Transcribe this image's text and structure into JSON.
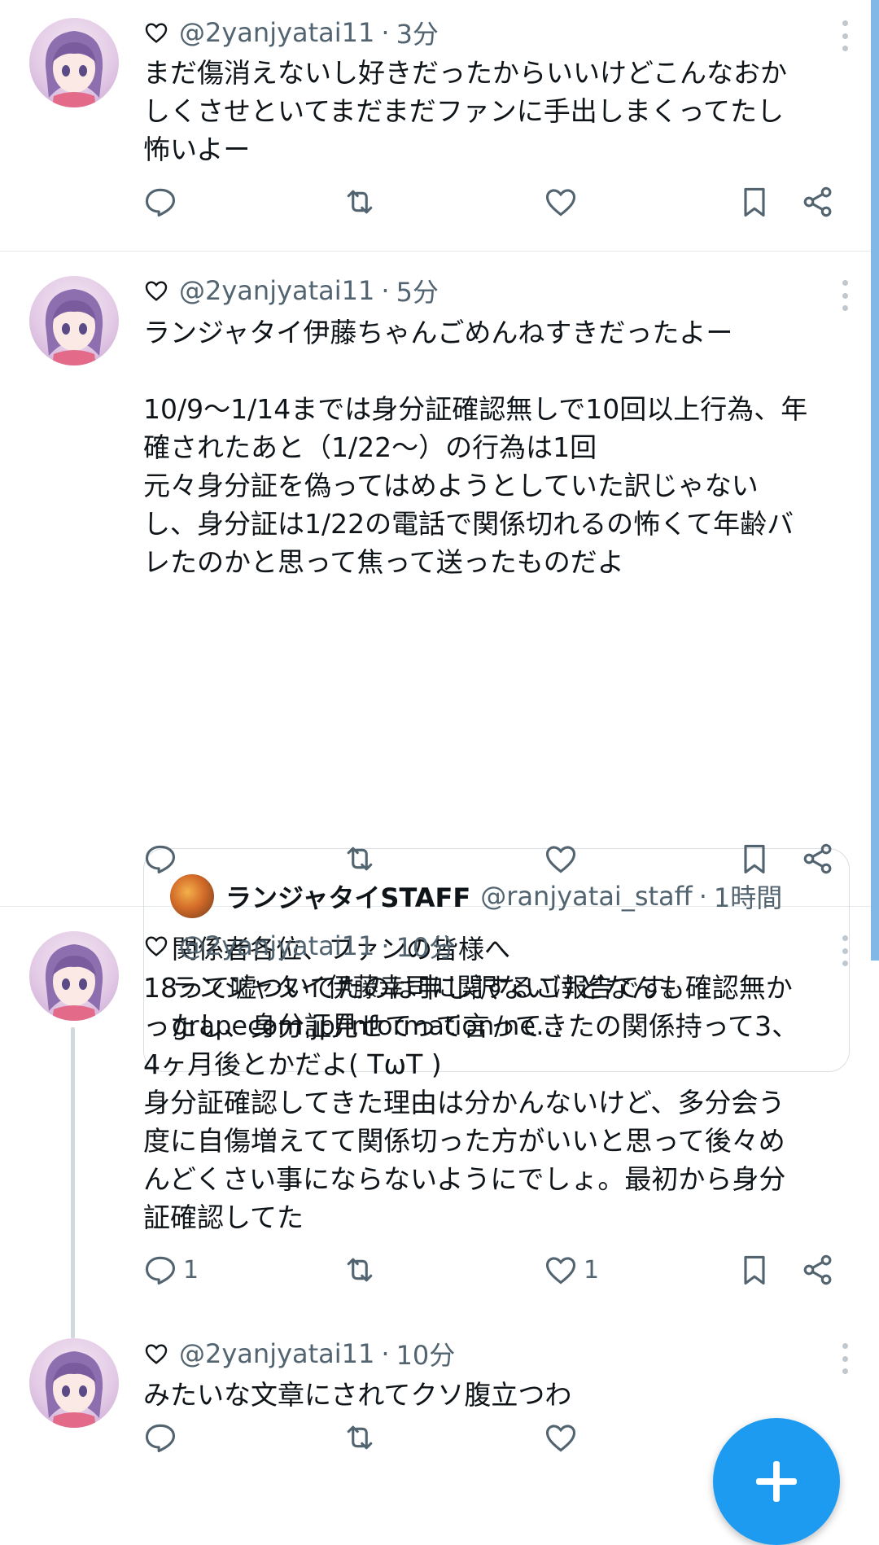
{
  "tweets": [
    {
      "handle": "@2yanjyatai11",
      "time": "3分",
      "text": "まだ傷消えないし好きだったからいいけどこんなおか\nしくさせといてまだまだファンに手出しまくってたし\n怖いよー",
      "reply_count": "",
      "like_count": ""
    },
    {
      "handle": "@2yanjyatai11",
      "time": "5分",
      "text": "ランジャタイ伊藤ちゃんごめんねすきだったよー\n\n10/9〜1/14までは身分証確認無しで10回以上行為、年\n確されたあと（1/22〜）の行為は1回\n元々身分証を偽ってはめようとしていた訳じゃない\nし、身分証は1/22の電話で関係切れるの怖くて年齢バ\nレたのかと思って焦って送ったものだよ",
      "quote": {
        "name": "ランジャタイSTAFF",
        "handle": "@ranjyatai_staff",
        "time": "1時間",
        "text": "関係者各位、ファンの皆様へ\nランジャタイ伊藤幸司に関するご報告です。\ngrapecom.jp/information/ne…"
      },
      "reply_count": "",
      "like_count": ""
    },
    {
      "handle": "@2yanjyatai11",
      "time": "10分",
      "text": "18って嘘ついてたのは申し訳ないけどなんも確認無か\nったし、身分証見せてって言ってきたの関係持って3、\n4ヶ月後とかだよ( TωT )\n身分証確認してきた理由は分かんないけど、多分会う\n度に自傷増えてて関係切った方がいいと思って後々め\nんどくさい事にならないようにでしょ。最初から身分\n証確認してた",
      "reply_count": "1",
      "like_count": "1"
    },
    {
      "handle": "@2yanjyatai11",
      "time": "10分",
      "text": "みたいな文章にされてクソ腹立つわ",
      "reply_count": "",
      "like_count": ""
    }
  ],
  "header_separator": "·",
  "icons": {
    "header": "heart-outline-icon",
    "reply": "reply-icon",
    "retweet": "retweet-icon",
    "like": "like-icon",
    "bookmark": "bookmark-icon",
    "share": "share-icon",
    "more": "more-vertical-icon",
    "compose": "plus-icon"
  },
  "colors": {
    "text": "#0f1419",
    "secondary": "#536471",
    "accent": "#1d9bf0",
    "divider": "#e6e9ec"
  }
}
